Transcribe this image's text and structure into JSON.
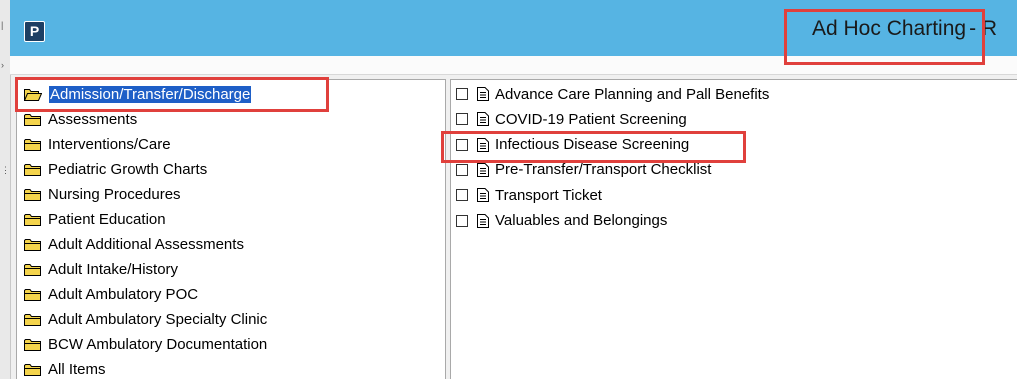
{
  "window": {
    "app_icon_letter": "P",
    "title": "Ad Hoc Charting",
    "title_suffix": "- R"
  },
  "folders": [
    {
      "label": "Admission/Transfer/Discharge",
      "selected": true
    },
    {
      "label": "Assessments"
    },
    {
      "label": "Interventions/Care"
    },
    {
      "label": "Pediatric Growth Charts"
    },
    {
      "label": "Nursing Procedures"
    },
    {
      "label": "Patient Education"
    },
    {
      "label": "Adult Additional Assessments"
    },
    {
      "label": "Adult Intake/History"
    },
    {
      "label": "Adult Ambulatory POC"
    },
    {
      "label": "Adult Ambulatory Specialty Clinic"
    },
    {
      "label": "BCW Ambulatory Documentation"
    },
    {
      "label": "All Items"
    }
  ],
  "documents": [
    {
      "label": "Advance Care Planning and Pall Benefits",
      "checked": false
    },
    {
      "label": "COVID-19 Patient Screening",
      "checked": false
    },
    {
      "label": "Infectious Disease Screening",
      "checked": false
    },
    {
      "label": "Pre-Transfer/Transport Checklist",
      "checked": false
    },
    {
      "label": "Transport Ticket",
      "checked": false
    },
    {
      "label": "Valuables and Belongings",
      "checked": false
    }
  ],
  "colors": {
    "titlebar": "#56b4e3",
    "selection": "#1e5fc7",
    "callout": "#e0403c",
    "folder": "#f4d44c"
  },
  "icons": {
    "folder_open": "folder-open-icon",
    "folder_closed": "folder-icon",
    "document": "document-icon"
  }
}
